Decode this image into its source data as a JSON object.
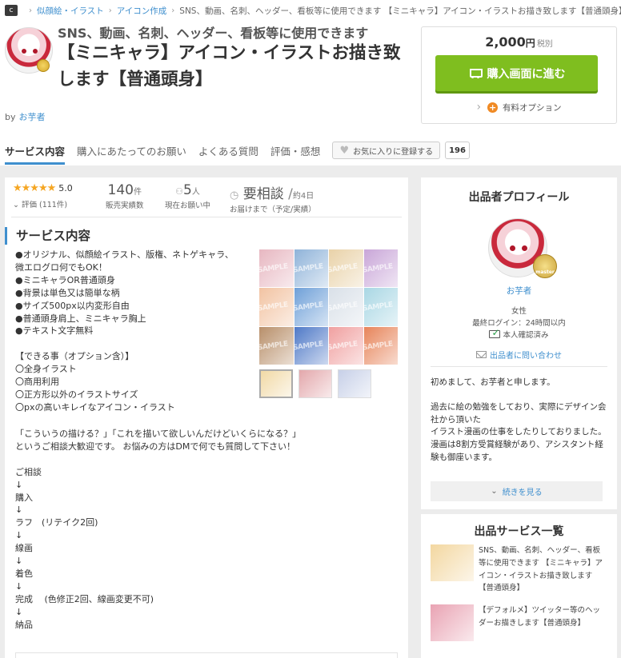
{
  "breadcrumb": {
    "home_icon": "c",
    "items": [
      "似顔絵・イラスト",
      "アイコン作成"
    ],
    "current": "SNS、動画、名刺、ヘッダー、看板等に使用できます 【ミニキャラ】アイコン・イラストお描き致します【普通頭身】"
  },
  "header": {
    "subtitle": "SNS、動画、名刺、ヘッダー、看板等に使用できます",
    "title": "【ミニキャラ】アイコン・イラストお描き致します【普通頭身】",
    "by_label": "by",
    "seller_name": "お芋者"
  },
  "purchase": {
    "price": "2,000",
    "currency": "円",
    "tax": "税別",
    "buy_label": "購入画面に進む",
    "option_label": "有料オプション"
  },
  "tabs": [
    {
      "label": "サービス内容",
      "active": true
    },
    {
      "label": "購入にあたってのお願い"
    },
    {
      "label": "よくある質問"
    },
    {
      "label": "評価・感想"
    }
  ],
  "favorite": {
    "label": "お気に入りに登録する",
    "count": "196"
  },
  "stats": {
    "rating_value": "5.0",
    "rating_label": "評価 (111件)",
    "sales_num": "140",
    "sales_unit": "件",
    "sales_label": "販売実績数",
    "requests_num": "5",
    "requests_unit": "人",
    "requests_label": "現在お願い中",
    "delivery_value": "要相談",
    "delivery_sub": "約4日",
    "delivery_label": "お届けまで（予定/実績）"
  },
  "service": {
    "section_title": "サービス内容",
    "description_top": "●オリジナル、似顔絵イラスト、版権、ネトゲキャラ、\n微エログロ何でもOK！\n●ミニキャラOR普通頭身\n●背景は単色又は簡単な柄\n●サイズ500px以内変形自由\n●普通頭身肩上、ミニキャラ胸上\n●テキスト文字無料\n\n【できる事（オプション含）】\n〇全身イラスト\n〇商用利用\n〇正方形以外のイラストサイズ\n〇pxの高いキレイなアイコン・イラスト",
    "description_bottom": "「こういうの描ける？」「これを描いて欲しいんだけどいくらになる？」\nというご相談大歓迎です。 お悩みの方はDMで何でも質問して下さい！\n\nご相談\n↓\n購入\n↓\nラフ　(リテイク2回)\n↓\n線画\n↓\n着色\n↓\n完成　 (色修正2回、線画変更不可)\n↓\n納品"
  },
  "gallery": {
    "tile_colors": [
      "#e7b7c1",
      "#8fb3d9",
      "#e9d2a8",
      "#c9a6d8",
      "#f2c3a2",
      "#6fa0d8",
      "#d9e0e8",
      "#a9d7e4",
      "#b88f6a",
      "#4f79c7",
      "#f0a0a0",
      "#e7845a"
    ],
    "thumb_colors": [
      "#f1d9a5",
      "#e3a7ab",
      "#c7d0e8"
    ]
  },
  "profile": {
    "heading": "出品者プロフィール",
    "name": "お芋者",
    "badge": "master",
    "gender": "女性",
    "last_login": "最終ログイン：24時間以内",
    "verified": "本人確認済み",
    "contact": "出品者に問い合わせ",
    "intro": "初めまして、お芋者と申します。\n\n過去に絵の勉強をしており、実際にデザイン会社から頂いた\nイラスト漫画の仕事をしたりしておりました。\n漫画は8割方受賞経験があり、アシスタント経験も御座います。",
    "more_label": "続きを見る"
  },
  "services_list": {
    "heading": "出品サービス一覧",
    "items": [
      {
        "text": "SNS、動画、名刺、ヘッダー、看板等に使用できます 【ミニキャラ】アイコン・イラストお描き致します【普通頭身】",
        "color": "#f3d7a0"
      },
      {
        "text": "【デフォルメ】ツイッター等のヘッダーお描きします【普通頭身】",
        "color": "#e9a3b3"
      }
    ]
  },
  "colors": {
    "accent": "#3f8fce",
    "buy": "#7fbe1f",
    "stars": "#f5a623",
    "option": "#f08a24"
  }
}
